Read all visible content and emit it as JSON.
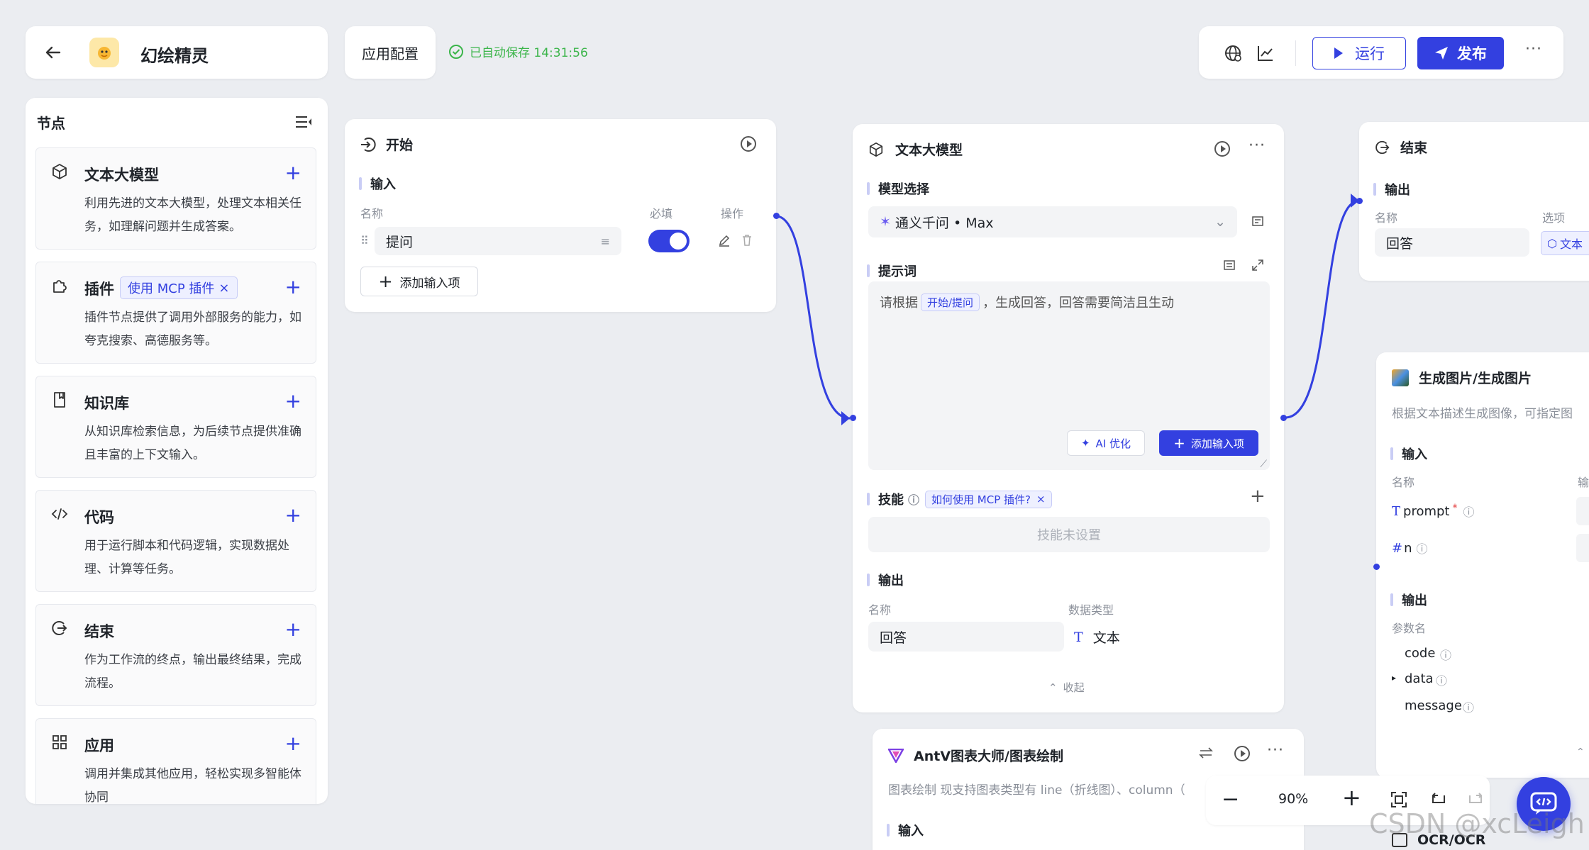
{
  "header": {
    "back_icon": "arrow-left-icon",
    "app_name": "幻绘精灵",
    "config_tab": "应用配置",
    "save_status": "已自动保存 14:31:56",
    "run_label": "运行",
    "publish_label": "发布"
  },
  "sidebar": {
    "title": "节点",
    "items": [
      {
        "title": "文本大模型",
        "desc": "利用先进的文本大模型，处理文本相关任务，如理解问题并生成答案。",
        "icon": "cube-icon"
      },
      {
        "title": "插件",
        "tag": "使用 MCP 插件",
        "desc": "插件节点提供了调用外部服务的能力，如夸克搜索、高德服务等。",
        "icon": "puzzle-icon"
      },
      {
        "title": "知识库",
        "desc": "从知识库检索信息，为后续节点提供准确且丰富的上下文输入。",
        "icon": "book-icon"
      },
      {
        "title": "代码",
        "desc": "用于运行脚本和代码逻辑，实现数据处理、计算等任务。",
        "icon": "code-icon"
      },
      {
        "title": "结束",
        "desc": "作为工作流的终点，输出最终结果，完成流程。",
        "icon": "exit-icon"
      },
      {
        "title": "应用",
        "desc": "调用并集成其他应用，轻松实现多智能体协同",
        "icon": "grid-icon"
      }
    ]
  },
  "start_node": {
    "title": "开始",
    "input_label": "输入",
    "col_name": "名称",
    "col_required": "必填",
    "col_action": "操作",
    "row_name": "提问",
    "add_input": "添加输入项"
  },
  "llm_node": {
    "title": "文本大模型",
    "model_label": "模型选择",
    "model_value": "通义千问 • Max",
    "prompt_label": "提示词",
    "prompt_prefix": "请根据",
    "prompt_tag": "开始/提问",
    "prompt_suffix": "，生成回答，回答需要简洁且生动",
    "ai_optimize": "AI 优化",
    "add_input": "添加输入项",
    "skill_label": "技能",
    "skill_tag": "如何使用 MCP 插件?",
    "skill_empty": "技能未设置",
    "output_label": "输出",
    "col_name": "名称",
    "col_type": "数据类型",
    "output_name": "回答",
    "output_type": "文本",
    "collapse": "收起"
  },
  "end_node": {
    "title": "结束",
    "output_label": "输出",
    "col_name": "名称",
    "col_option": "选项",
    "output_name": "回答",
    "option_tag": "文本"
  },
  "image_node": {
    "title": "生成图片/生成图片",
    "desc": "根据文本描述生成图像，可指定图",
    "input_label": "输入",
    "col_name": "名称",
    "col_input_partial": "输",
    "params": [
      "prompt",
      "n"
    ],
    "output_label": "输出",
    "col_param": "参数名",
    "outputs": [
      "code",
      "data",
      "message"
    ]
  },
  "antv_node": {
    "title": "AntV图表大师/图表绘制",
    "desc": "图表绘制 现支持图表类型有 line（折线图）、column（",
    "input_label": "输入"
  },
  "ocr_node": {
    "title": "OCR/OCR"
  },
  "zoom": {
    "level": "90%"
  },
  "watermark": "CSDN @xcLeigh",
  "colors": {
    "accent": "#3340e0",
    "success": "#3bb54a",
    "canvas": "#ebedf1"
  }
}
